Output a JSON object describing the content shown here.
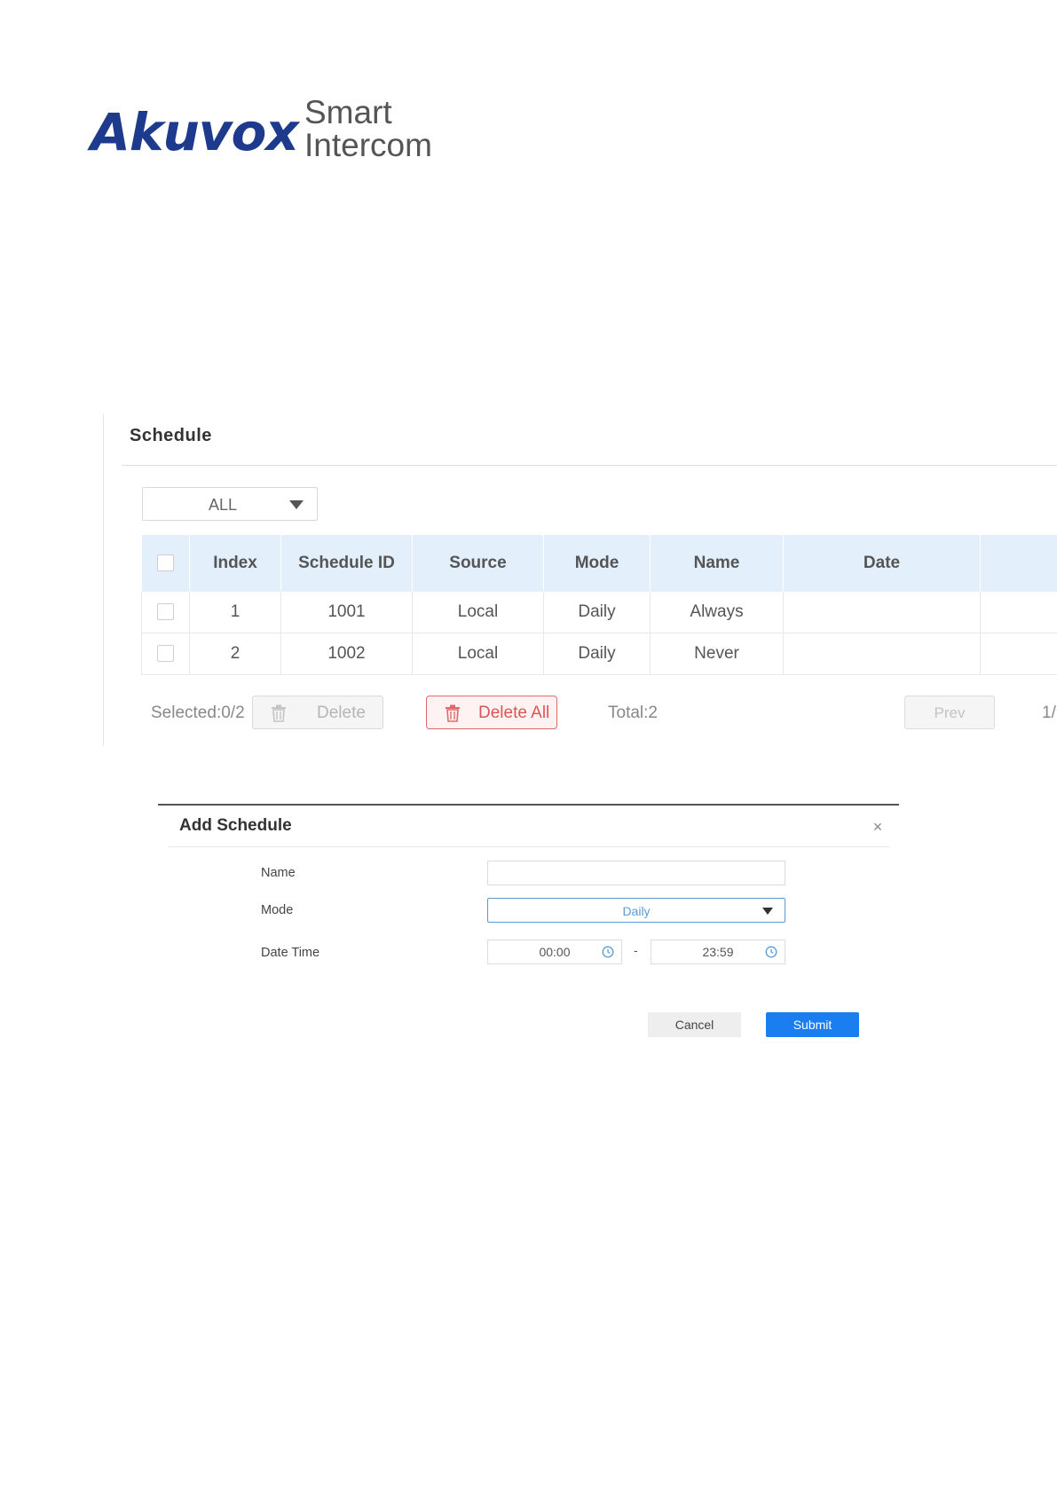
{
  "logo": {
    "brand": "Akuvox",
    "tagline_line1": "Smart",
    "tagline_line2": "Intercom"
  },
  "schedule_panel": {
    "title": "Schedule",
    "filter_value": "ALL",
    "table": {
      "headers": [
        "Index",
        "Schedule ID",
        "Source",
        "Mode",
        "Name",
        "Date"
      ],
      "rows": [
        {
          "index": "1",
          "schedule_id": "1001",
          "source": "Local",
          "mode": "Daily",
          "name": "Always",
          "date": ""
        },
        {
          "index": "2",
          "schedule_id": "1002",
          "source": "Local",
          "mode": "Daily",
          "name": "Never",
          "date": ""
        }
      ]
    },
    "footer": {
      "selected": "Selected:0/2",
      "delete_label": "Delete",
      "delete_all_label": "Delete All",
      "total": "Total:2",
      "prev_label": "Prev",
      "page": "1/"
    }
  },
  "add_dialog": {
    "title": "Add Schedule",
    "close": "×",
    "name_label": "Name",
    "name_value": "",
    "mode_label": "Mode",
    "mode_value": "Daily",
    "datetime_label": "Date Time",
    "start_time": "00:00",
    "separator": "-",
    "end_time": "23:59",
    "cancel_label": "Cancel",
    "submit_label": "Submit"
  },
  "colors": {
    "brand": "#1e3a8c",
    "header_bg": "#e3effb",
    "danger": "#e05353",
    "primary": "#1a7ef0"
  }
}
